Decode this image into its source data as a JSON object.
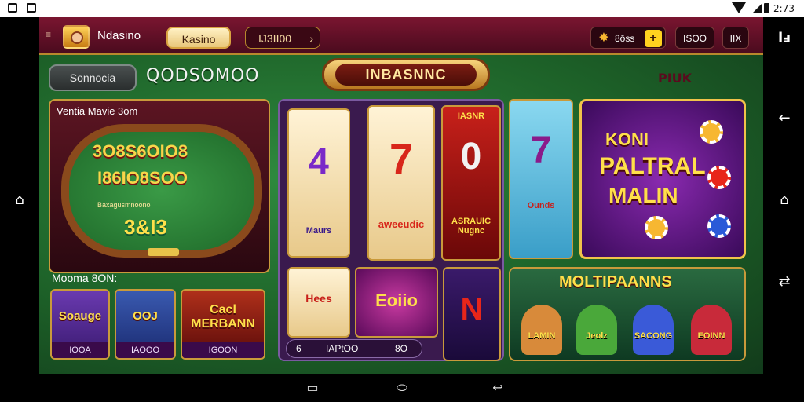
{
  "status_bar": {
    "time": "2:73",
    "left_icons": [
      "notification-icon",
      "image-icon"
    ],
    "right_icons": [
      "wifi-icon",
      "signal-icon",
      "battery-icon"
    ]
  },
  "side_rails": {
    "left_home": "⌂",
    "right_logo": "ⅼⅎ",
    "right_back": "←",
    "right_home": "⌂",
    "right_recents": "⇄"
  },
  "topbar": {
    "app_name": "Ndasino",
    "tab_active": "Kasino",
    "balance": "IJ3II00",
    "balance_arrow": "›",
    "coins": "8ōss",
    "coin_add": "+",
    "gems": "ISOO",
    "menu_label": "IIX"
  },
  "filter_pill": "Sonnocia",
  "big_code": "QODSOMOO",
  "banner_title": "INBASNNC",
  "corner_label": "PIUK",
  "table_panel": {
    "title": "Ventia Mavie 3om",
    "row1": "3O8S6OIO8",
    "row2": "I86IO8SOO",
    "fine": "Baxagusmnoono",
    "multi": "3&I3"
  },
  "promo": {
    "label": "Mooma 8ON:",
    "thumbs": [
      {
        "title": "Soauge",
        "caption": "IOOA"
      },
      {
        "title": "OOJ",
        "caption": "IAOOO"
      },
      {
        "title": "Cacl MERBANN",
        "caption": "IGOON"
      }
    ]
  },
  "reels": {
    "symbols": [
      "4",
      "7",
      "0",
      "7",
      "Maurs",
      "aweeudic",
      "ASRAUIC Nugnc",
      "Ounds",
      "Hees",
      "Eoiio",
      "N"
    ],
    "header_small": "IASNR",
    "bar_left": "6",
    "bar_mid": "IAPtOO",
    "bar_right": "8O"
  },
  "featured": {
    "line1": "KONI",
    "line2": "PALTRAL",
    "line3": "MALIN"
  },
  "multi_card": {
    "title": "MOLTIPAANNS",
    "chars": [
      "LAMIN",
      "Jeolz",
      "SACONG",
      "EOINN"
    ]
  },
  "colors": {
    "top": "#7a1530",
    "felt": "#1d6128",
    "gold": "#f0c34a",
    "purple": "#3a0a5a"
  }
}
